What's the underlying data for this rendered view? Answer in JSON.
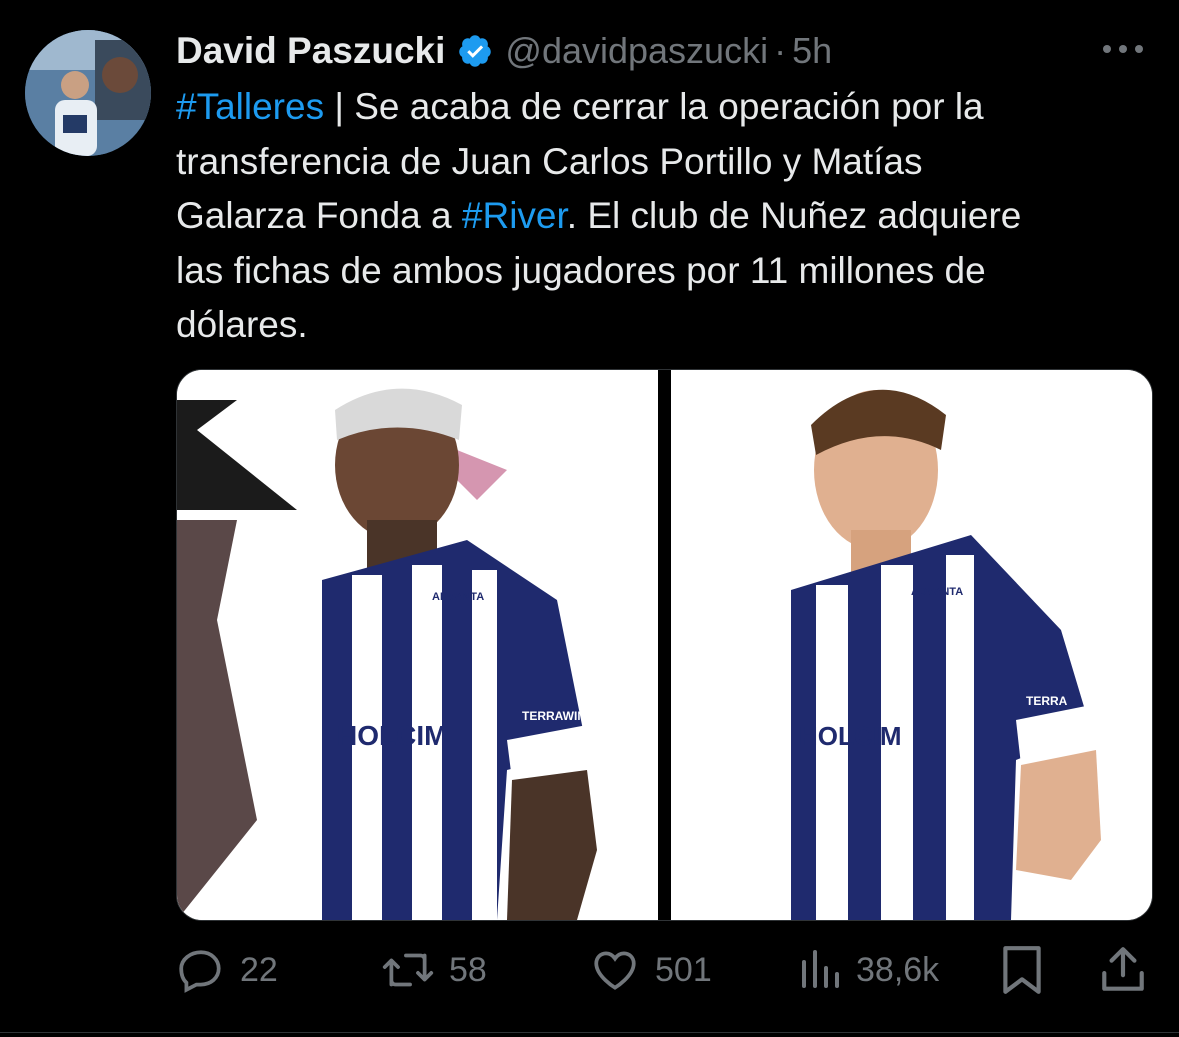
{
  "tweet": {
    "author_name": "David Paszucki",
    "handle": "@davidpaszucki",
    "separator": "·",
    "time": "5h",
    "text_lines": [
      {
        "link": "#Talleres",
        "rest": " | Se acaba de cerrar la operación por la"
      },
      {
        "plain": "transferencia de Juan Carlos Portillo y Matías"
      },
      {
        "pre": "Galarza Fonda a ",
        "link": "#River",
        "post": ". El club de Nuñez adquiere"
      },
      {
        "plain": "las fichas de ambos jugadores por 11 millones de"
      },
      {
        "plain": "dólares."
      }
    ],
    "media": [
      {
        "jersey_sponsor": "HOLCIM",
        "sleeve": "TERRAWIND",
        "chest": "ADVANTA"
      },
      {
        "jersey_sponsor": "HOLCIM",
        "sleeve": "TERRA",
        "chest": "ADVANTA"
      }
    ]
  },
  "actions": {
    "replies": "22",
    "retweets": "58",
    "likes": "501",
    "views": "38,6k"
  },
  "colors": {
    "background": "#000000",
    "text": "#e7e9ea",
    "secondary": "#71767b",
    "link": "#1d9bf0",
    "verified": "#1d9bf0",
    "jersey_blue": "#1f2a6e"
  },
  "icons": [
    "verified-badge-icon",
    "more-icon",
    "reply-icon",
    "retweet-icon",
    "like-icon",
    "views-icon",
    "bookmark-icon",
    "share-icon"
  ]
}
